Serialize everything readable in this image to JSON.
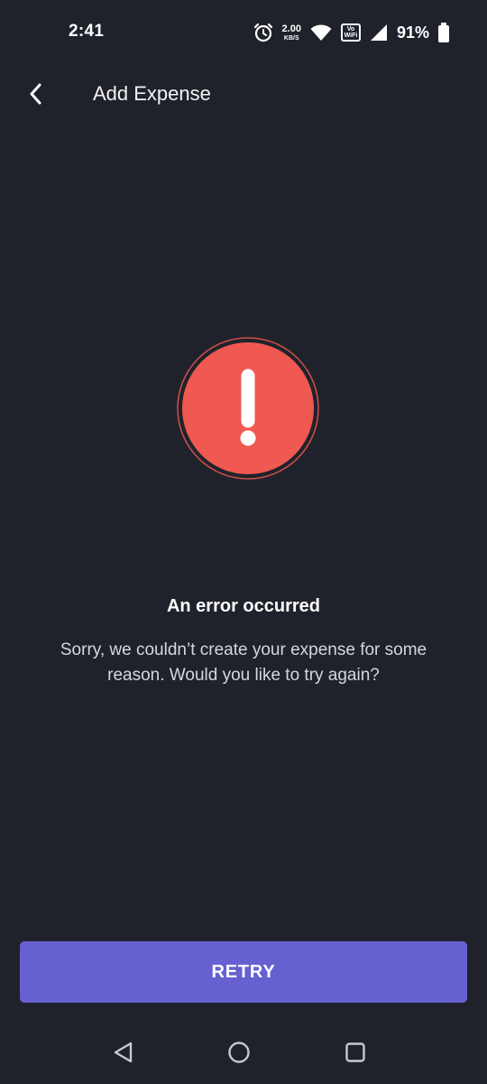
{
  "status_bar": {
    "time": "2:41",
    "network_speed": "2.00",
    "network_speed_unit": "KB/S",
    "vowifi_top": "Vo",
    "vowifi_bottom": "WiFi",
    "battery_percent": "91%",
    "icons": [
      "alarm-icon",
      "wifi-icon",
      "vowifi-icon",
      "cellular-signal-icon",
      "battery-icon"
    ]
  },
  "app_bar": {
    "title": "Add Expense",
    "back_icon": "chevron-left-icon"
  },
  "error": {
    "icon": "error-exclamation-icon",
    "title": "An error occurred",
    "message": "Sorry, we couldn’t create your expense for some reason. Would you like to try again?"
  },
  "actions": {
    "retry_label": "RETRY"
  },
  "nav_bar": {
    "icons": [
      "back-triangle-icon",
      "home-circle-icon",
      "recents-square-icon"
    ]
  },
  "colors": {
    "background": "#20222b",
    "error_red": "#f05852",
    "accent": "#6660d1"
  }
}
